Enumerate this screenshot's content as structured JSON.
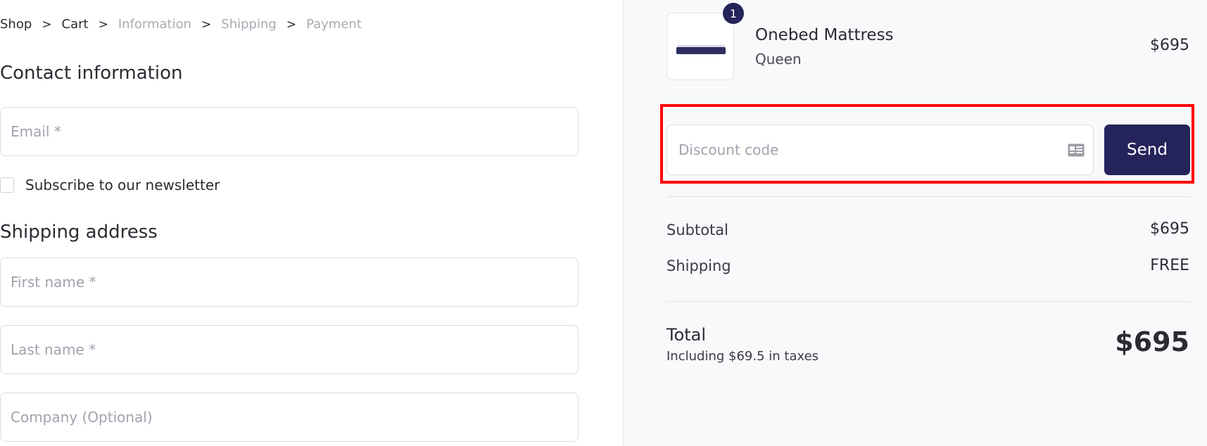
{
  "breadcrumb": {
    "items": [
      {
        "label": "Shop"
      },
      {
        "label": "Cart"
      },
      {
        "label": "Information"
      },
      {
        "label": "Shipping"
      },
      {
        "label": "Payment"
      }
    ],
    "separator": ">"
  },
  "contact": {
    "heading": "Contact information",
    "email_placeholder": "Email *",
    "newsletter_label": "Subscribe to our newsletter"
  },
  "shipping": {
    "heading": "Shipping address",
    "first_name_placeholder": "First name *",
    "last_name_placeholder": "Last name *",
    "company_placeholder": "Company (Optional)"
  },
  "summary": {
    "product": {
      "name": "Onebed Mattress",
      "variant": "Queen",
      "price": "$695",
      "quantity": "1"
    },
    "discount": {
      "placeholder": "Discount code",
      "button_label": "Send"
    },
    "subtotal_label": "Subtotal",
    "subtotal_value": "$695",
    "shipping_label": "Shipping",
    "shipping_value": "FREE",
    "total_label": "Total",
    "tax_note": "Including $69.5 in taxes",
    "total_value": "$695"
  },
  "colors": {
    "accent": "#24245a",
    "highlight": "#ff0000",
    "summary_bg": "#f8f9fb"
  },
  "icons": [
    "mattress-image",
    "id-card-icon"
  ]
}
